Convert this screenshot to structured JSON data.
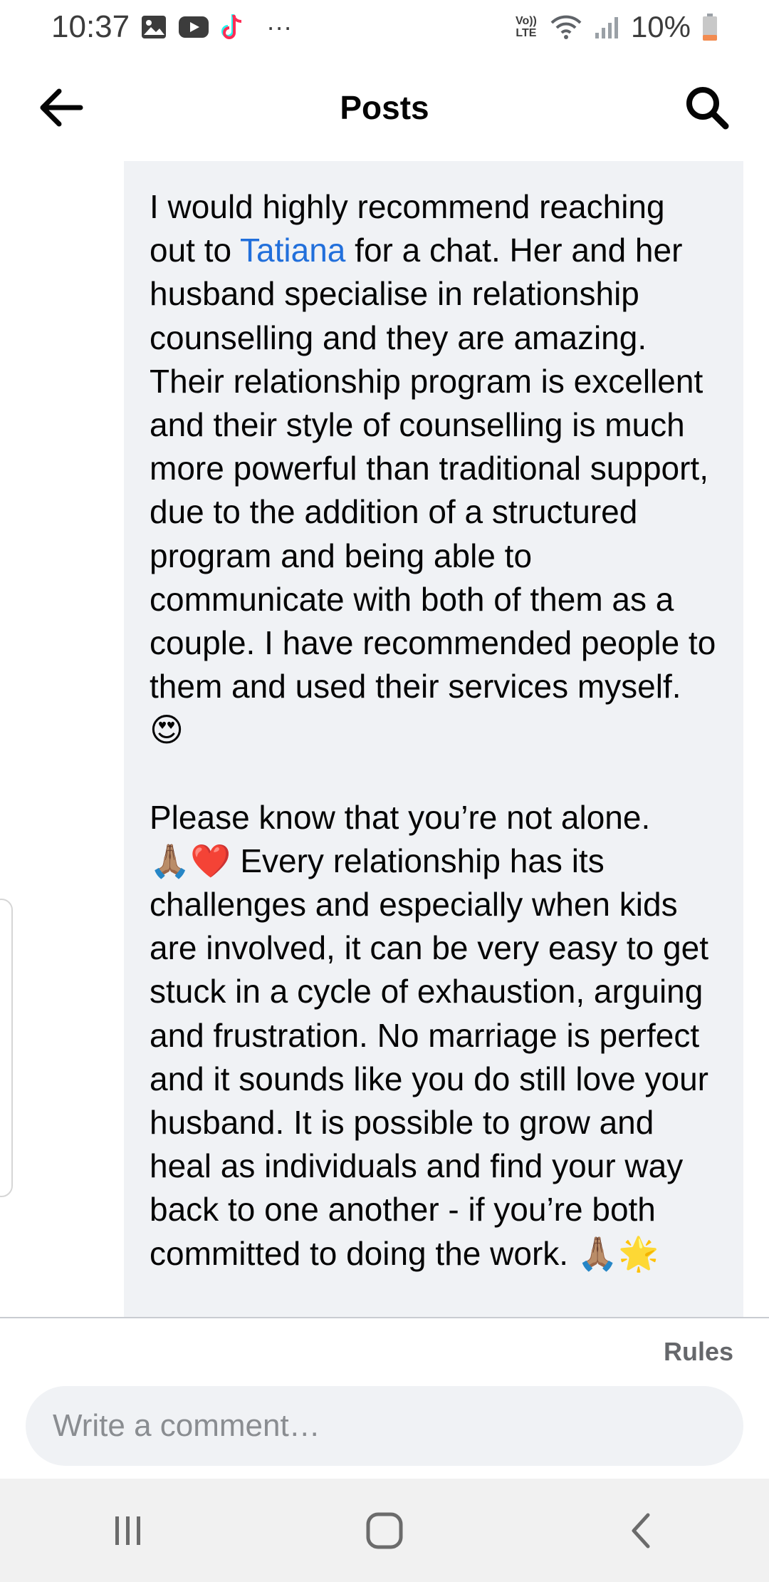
{
  "status_bar": {
    "time": "10:37",
    "more": "···",
    "network_label": "Vo)) LTE",
    "battery": "10%",
    "icons": [
      "gallery-icon",
      "youtube-icon",
      "tiktok-icon",
      "wifi-icon",
      "signal-icon",
      "battery-icon"
    ],
    "battery_fill_percent": 10
  },
  "header": {
    "title": "Posts",
    "back_icon": "arrow-left-icon",
    "search_icon": "search-icon"
  },
  "comment": {
    "paragraph1_before_mention": "I would highly recommend reaching out to ",
    "mention": "Tatiana",
    "paragraph1_after_mention": " for a chat. Her and her husband specialise in relationship counselling and they are amazing. Their relationship program is excellent and their style of counselling is much more powerful than traditional support, due to the addition of a structured program and being able to communicate with both of them as a couple. I have recommended people to them and used their services myself. ",
    "emoji1": "😍",
    "paragraph2_line1": "Please know that you’re not alone.",
    "emoji2": "🙏🏽❤️",
    "paragraph2_rest": " Every relationship has its challenges and especially when kids are involved, it can be very easy to get stuck in a cycle of exhaustion, arguing and frustration. No marriage is perfect and it sounds like you do still love your husband. It is possible to grow and heal as individuals and find your way back to one another - if you’re both committed to doing the work. ",
    "emoji3": "🙏🏽🌟"
  },
  "footer": {
    "rules_label": "Rules",
    "comment_placeholder": "Write a comment…"
  },
  "nav_bar": {
    "buttons": [
      "recent-apps-icon",
      "home-icon",
      "back-icon"
    ]
  },
  "colors": {
    "mention": "#216fdb",
    "bubble_bg": "#f0f2f5",
    "text": "#050505",
    "muted": "#65676b"
  }
}
